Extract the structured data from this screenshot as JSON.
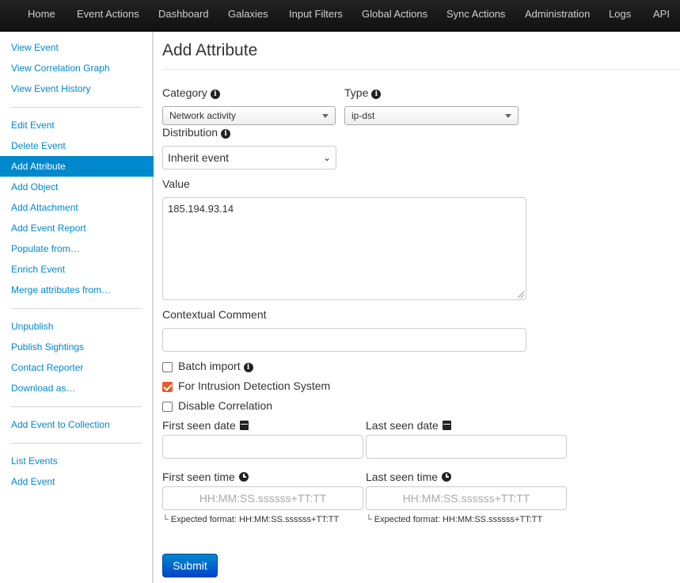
{
  "nav": {
    "items": [
      "Home",
      "Event Actions",
      "Dashboard",
      "Galaxies",
      "Input Filters",
      "Global Actions",
      "Sync Actions",
      "Administration",
      "Logs",
      "API"
    ]
  },
  "sidebar": {
    "group1": [
      "View Event",
      "View Correlation Graph",
      "View Event History"
    ],
    "group2": [
      "Edit Event",
      "Delete Event",
      "Add Attribute",
      "Add Object",
      "Add Attachment",
      "Add Event Report",
      "Populate from…",
      "Enrich Event",
      "Merge attributes from…"
    ],
    "group3": [
      "Unpublish",
      "Publish Sightings",
      "Contact Reporter",
      "Download as…"
    ],
    "group4": [
      "Add Event to Collection"
    ],
    "group5": [
      "List Events",
      "Add Event"
    ],
    "active": "Add Attribute"
  },
  "form": {
    "title": "Add Attribute",
    "category_label": "Category",
    "category_value": "Network activity",
    "type_label": "Type",
    "type_value": "ip-dst",
    "distribution_label": "Distribution",
    "distribution_value": "Inherit event",
    "value_label": "Value",
    "value_text": "185.194.93.14",
    "comment_label": "Contextual Comment",
    "comment_value": "",
    "batch_label": "Batch import",
    "batch_checked": false,
    "ids_label": "For Intrusion Detection System",
    "ids_checked": true,
    "disable_corr_label": "Disable Correlation",
    "disable_corr_checked": false,
    "first_seen_date_label": "First seen date",
    "last_seen_date_label": "Last seen date",
    "first_seen_time_label": "First seen time",
    "last_seen_time_label": "Last seen time",
    "time_placeholder": "HH:MM:SS.ssssss+TT:TT",
    "time_hint": "Expected format: HH:MM:SS.ssssss+TT:TT",
    "submit_label": "Submit"
  },
  "colors": {
    "accent": "#0088cc",
    "checkbox_checked": "#e75a2d",
    "navbar": "#1b1b1b"
  },
  "icons": [
    "info-icon",
    "calendar-icon",
    "clock-icon",
    "chevron-down-icon"
  ]
}
